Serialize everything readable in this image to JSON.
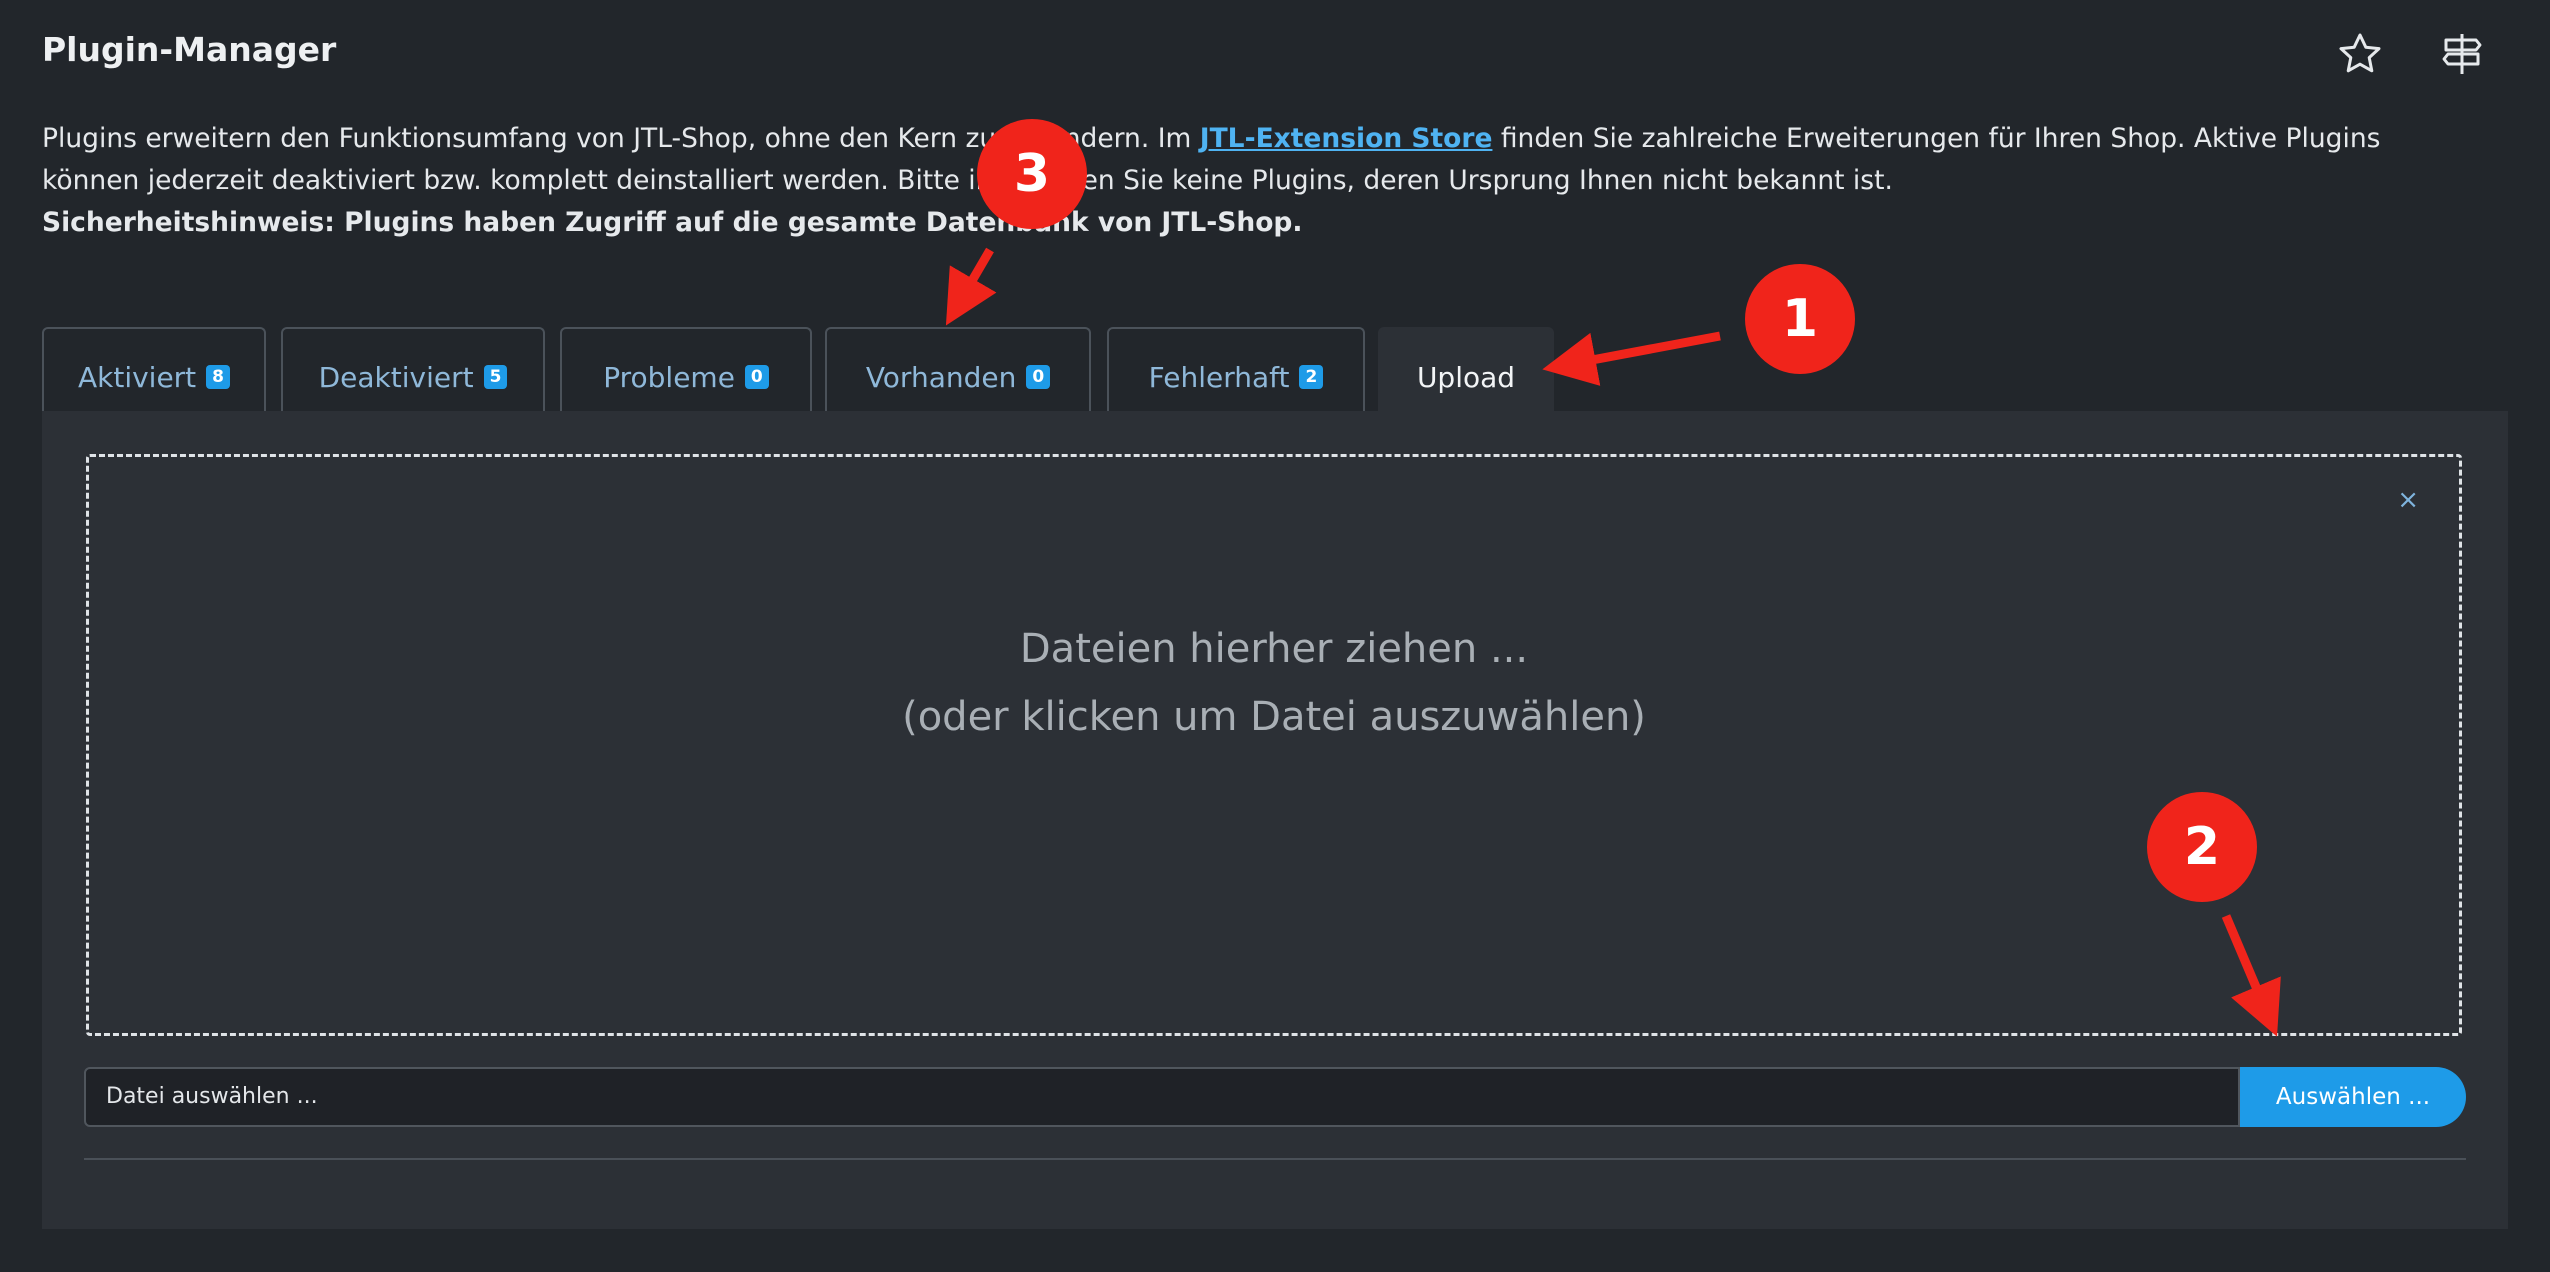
{
  "header": {
    "title": "Plugin-Manager",
    "icons": [
      "star-icon",
      "signpost-icon"
    ]
  },
  "intro": {
    "text_before_link": "Plugins erweitern den Funktionsumfang von JTL-Shop, ohne den Kern zu verändern. Im ",
    "link_text": "JTL-Extension Store",
    "text_after_link": " finden Sie zahlreiche Erweiterungen für Ihren Shop. Aktive Plugins können jederzeit deaktiviert bzw. komplett deinstalliert werden. Bitte installieren Sie keine Plugins, deren Ursprung Ihnen nicht bekannt ist.",
    "security_note": "Sicherheitshinweis: Plugins haben Zugriff auf die gesamte Datenbank von JTL-Shop."
  },
  "tabs": [
    {
      "label": "Aktiviert",
      "count": "8"
    },
    {
      "label": "Deaktiviert",
      "count": "5"
    },
    {
      "label": "Probleme",
      "count": "0"
    },
    {
      "label": "Vorhanden",
      "count": "0"
    },
    {
      "label": "Fehlerhaft",
      "count": "2"
    },
    {
      "label": "Upload",
      "active": true
    }
  ],
  "upload": {
    "close_glyph": "×",
    "drop_line1": "Dateien hierher ziehen ...",
    "drop_line2": "(oder klicken um Datei auszuwählen)",
    "file_input_text": "Datei auswählen ...",
    "select_button": "Auswählen ..."
  },
  "annotations": {
    "marker1": "1",
    "marker2": "2",
    "marker3": "3",
    "color": "#f0241b"
  },
  "colors": {
    "background": "#22262b",
    "panel": "#2c3036",
    "accent": "#1e9be8",
    "link": "#4fb3f2"
  }
}
